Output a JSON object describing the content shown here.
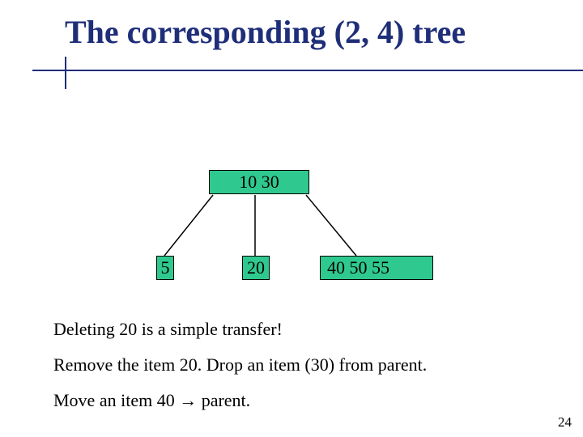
{
  "title": "The corresponding (2, 4) tree",
  "tree": {
    "root": {
      "label": "10 30"
    },
    "children": [
      {
        "label": "5"
      },
      {
        "label": "20"
      },
      {
        "label": "40  50  55"
      }
    ]
  },
  "lines": [
    "Deleting 20 is a simple transfer!",
    "Remove the item 20. Drop an item (30) from parent.",
    "Move an item 40 "
  ],
  "line3_suffix": " parent.",
  "arrow_glyph": "→",
  "page_number": "24",
  "colors": {
    "accent": "#1f2e79",
    "node_fill": "#2fc98f"
  }
}
